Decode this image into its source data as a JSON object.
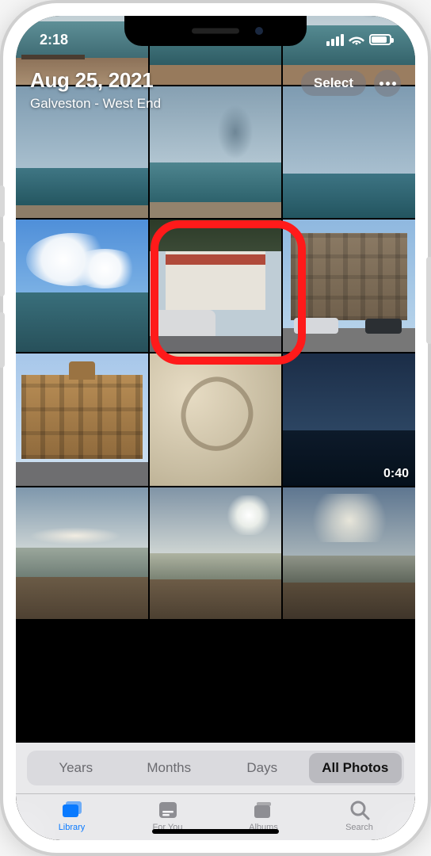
{
  "status": {
    "time": "2:18"
  },
  "header": {
    "date": "Aug 25, 2021",
    "location": "Galveston - West End",
    "select_label": "Select"
  },
  "grid": {
    "video_duration": "0:40"
  },
  "segmented": {
    "years": "Years",
    "months": "Months",
    "days": "Days",
    "all": "All Photos"
  },
  "tabs": {
    "library": "Library",
    "foryou": "For You",
    "albums": "Albums",
    "search": "Search"
  }
}
